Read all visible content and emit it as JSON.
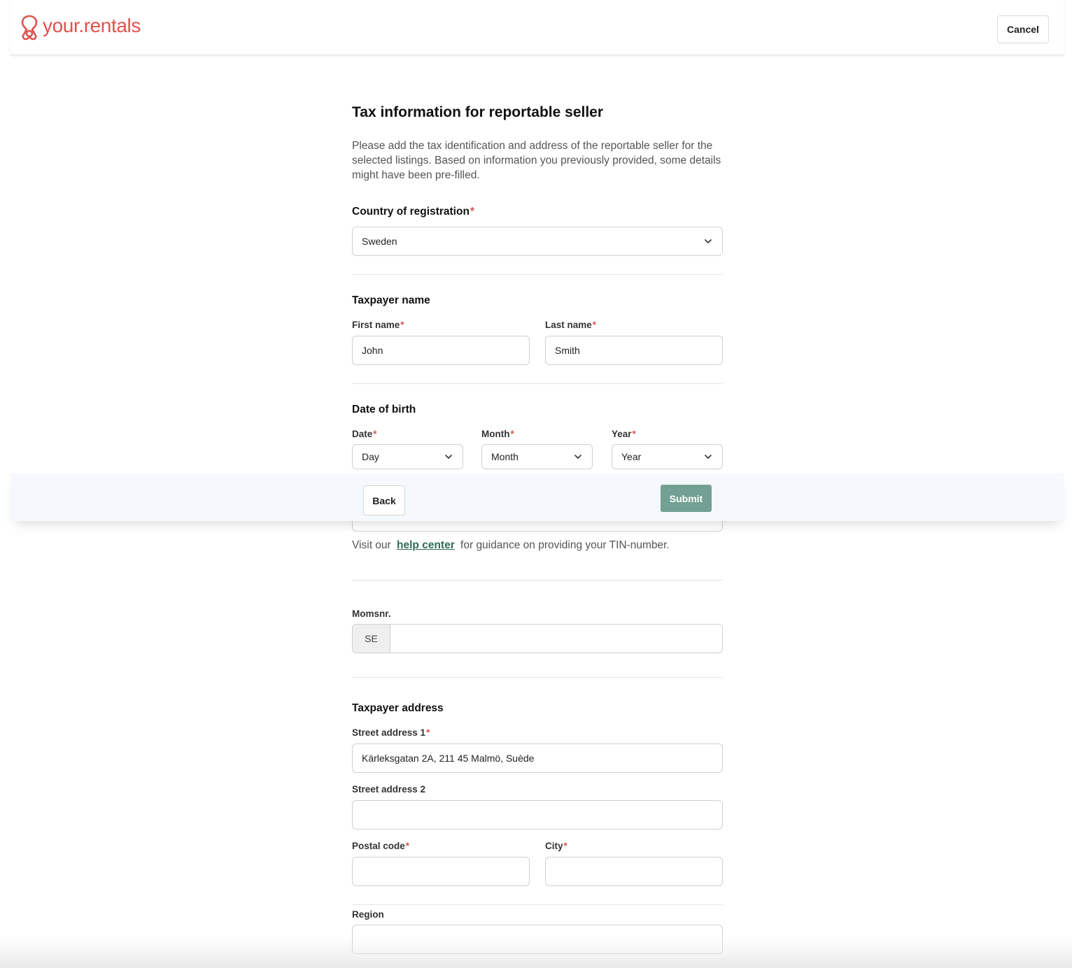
{
  "header": {
    "logo_text": "your.rentals",
    "cancel_label": "Cancel"
  },
  "form": {
    "title": "Tax information for reportable seller",
    "description": "Please add the tax identification and address of the reportable seller for the selected listings. Based on information you previously provided, some details might have been pre-filled.",
    "country": {
      "label": "Country of registration",
      "value": "Sweden"
    },
    "taxpayer_name": {
      "section_title": "Taxpayer name",
      "first_name_label": "First name",
      "first_name_value": "John",
      "last_name_label": "Last name",
      "last_name_value": "Smith"
    },
    "date_of_birth": {
      "section_title": "Date of birth",
      "date_label": "Date",
      "date_value": "Day",
      "month_label": "Month",
      "month_value": "Month",
      "year_label": "Year",
      "year_value": "Year"
    },
    "help": {
      "prefix": "Visit our",
      "link": "help center",
      "suffix": "for guidance on providing your TIN-number."
    },
    "vat": {
      "label": "Momsnr.",
      "prefix": "SE",
      "value": ""
    },
    "address": {
      "section_title": "Taxpayer address",
      "street1_label": "Street address 1",
      "street1_value": "Kärleksgatan 2A, 211 45 Malmö, Suède",
      "street2_label": "Street address 2",
      "street2_value": "",
      "postal_label": "Postal code",
      "postal_value": "",
      "city_label": "City",
      "city_value": "",
      "region_label": "Region",
      "region_value": ""
    },
    "required_marker": "*"
  },
  "footer": {
    "back_label": "Back",
    "submit_label": "Submit"
  },
  "colors": {
    "brand": "#e0524f",
    "submit": "#72a092",
    "link": "#2f6b55",
    "required": "#d9534f"
  }
}
